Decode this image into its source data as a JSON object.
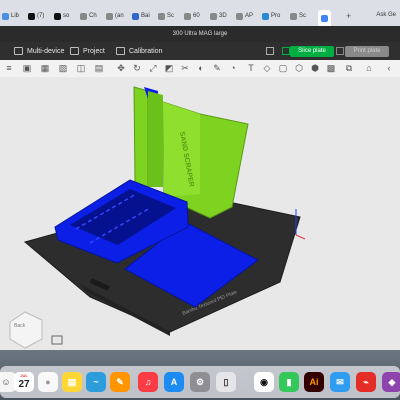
{
  "browser": {
    "tabs": [
      {
        "label": "Lib",
        "color": "#4a90e2"
      },
      {
        "label": "(7)",
        "color": "#111111"
      },
      {
        "label": "so",
        "color": "#111111"
      },
      {
        "label": "Ch",
        "color": "#888888"
      },
      {
        "label": "(an",
        "color": "#888888"
      },
      {
        "label": "Bai",
        "color": "#3366cc"
      },
      {
        "label": "Sc",
        "color": "#888888"
      },
      {
        "label": "60",
        "color": "#888888"
      },
      {
        "label": "3D",
        "color": "#888888"
      },
      {
        "label": "AP",
        "color": "#888888"
      },
      {
        "label": "Pro",
        "color": "#2a8ad4"
      },
      {
        "label": "Sc",
        "color": "#888888"
      },
      {
        "label": "Ask Ge",
        "color": "#4285f4"
      }
    ],
    "new_tab": "+"
  },
  "app": {
    "title": "300 Ultra MAG large",
    "menu": {
      "multi_device": "Multi-device",
      "project": "Project",
      "calibration": "Calibration"
    },
    "slice_plate": "Slice plate",
    "print_plate": "Print plate",
    "accent": "#00ae42"
  },
  "viewport": {
    "cube_label": "Back",
    "plate_text": "Bambu Textured PEI Plate",
    "model_text": "SAND SCRAPER",
    "colors": {
      "green": "#7ed321",
      "blue": "#0b1fe6",
      "plate": "#2a2a2a"
    }
  },
  "dock": {
    "calendar_month": "JUL",
    "calendar_day": "27",
    "ai_label": "Ai"
  }
}
